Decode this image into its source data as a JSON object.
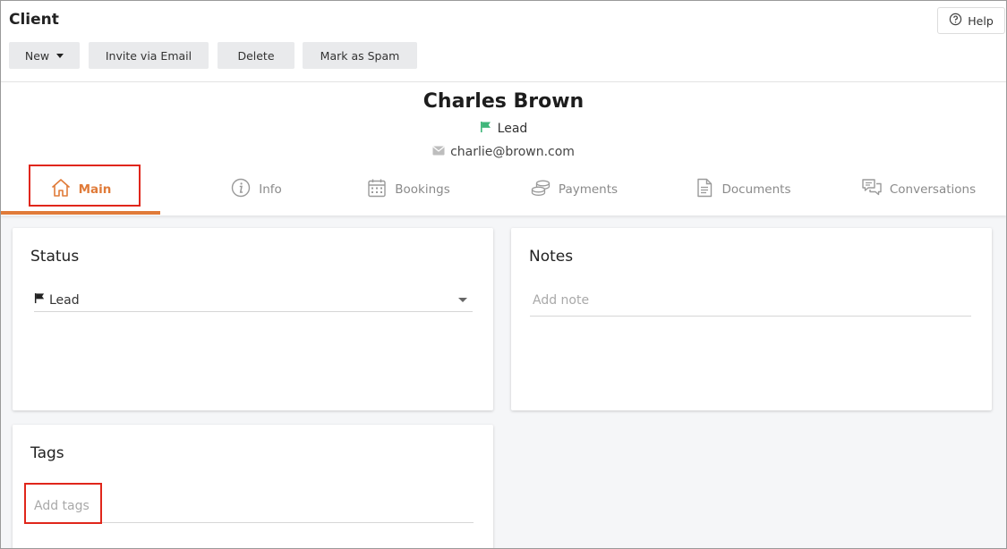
{
  "header": {
    "title": "Client",
    "help_label": "Help",
    "toolbar": {
      "new_label": "New",
      "invite_label": "Invite via Email",
      "delete_label": "Delete",
      "spam_label": "Mark as Spam"
    }
  },
  "client": {
    "name": "Charles Brown",
    "status": "Lead",
    "email": "charlie@brown.com"
  },
  "tabs": [
    {
      "label": "Main",
      "icon": "home-icon",
      "active": true
    },
    {
      "label": "Info",
      "icon": "info-icon"
    },
    {
      "label": "Bookings",
      "icon": "calendar-icon"
    },
    {
      "label": "Payments",
      "icon": "coins-icon"
    },
    {
      "label": "Documents",
      "icon": "document-icon"
    },
    {
      "label": "Conversations",
      "icon": "chat-icon"
    }
  ],
  "status_card": {
    "title": "Status",
    "selected": "Lead"
  },
  "notes_card": {
    "title": "Notes",
    "placeholder": "Add note"
  },
  "tags_card": {
    "title": "Tags",
    "placeholder": "Add tags"
  },
  "colors": {
    "accent": "#e07b39",
    "lead_flag": "#3fb67a",
    "highlight": "#e0261b"
  }
}
